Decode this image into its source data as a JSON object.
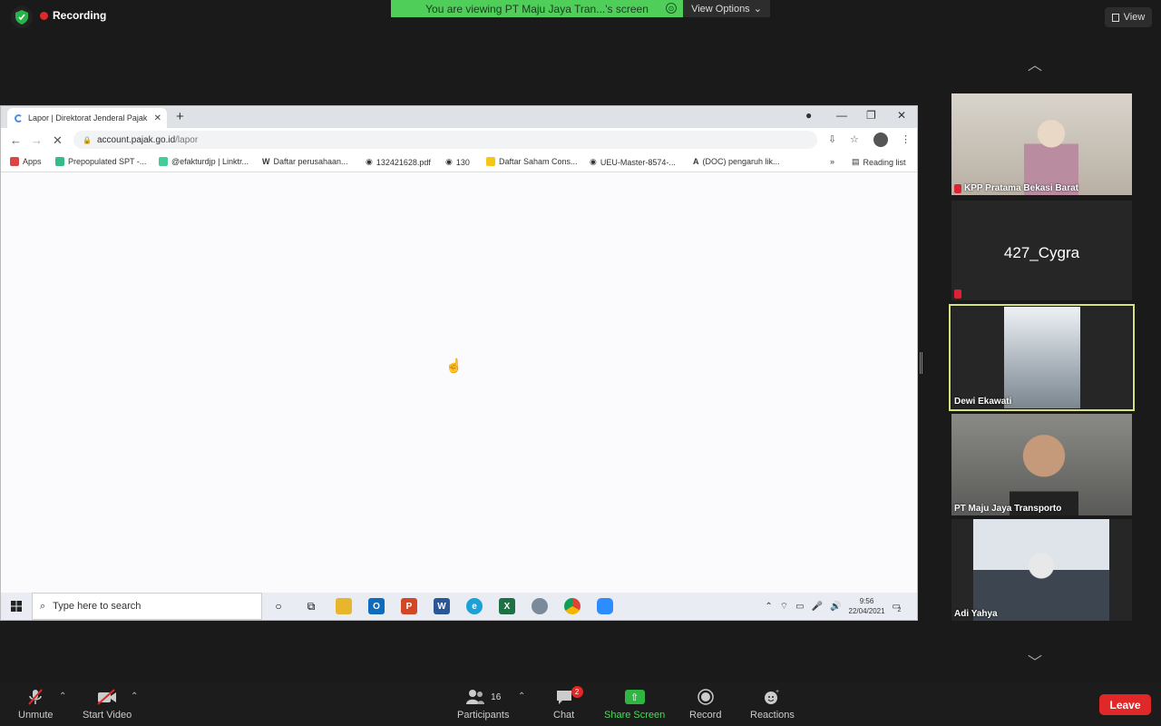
{
  "recording": {
    "label": "Recording"
  },
  "banner": {
    "viewing": "You are viewing PT Maju Jaya Tran...'s screen",
    "view_options": "View Options"
  },
  "view_button": {
    "label": "View"
  },
  "browser": {
    "tab_title": "Lapor | Direktorat Jenderal Pajak",
    "url_host": "account.pajak.go.id",
    "url_path": "/lapor",
    "bookmarks": [
      "Apps",
      "Prepopulated SPT -...",
      "@efakturdjp | Linktr...",
      "Daftar perusahaan...",
      "132421628.pdf",
      "130",
      "Daftar Saham Cons...",
      "UEU-Master-8574-...",
      "(DOC) pengaruh lik..."
    ],
    "reading_list": "Reading list"
  },
  "taskbar": {
    "search_placeholder": "Type here to search",
    "time": "9:56",
    "date": "22/04/2021",
    "notifications": "2"
  },
  "participants": [
    {
      "name": "KPP Pratama Bekasi Barat"
    },
    {
      "name": "427_Cygra"
    },
    {
      "name": "Dewi Ekawati"
    },
    {
      "name": "PT Maju Jaya Transporto"
    },
    {
      "name": "Adi Yahya"
    }
  ],
  "toolbar": {
    "unmute": "Unmute",
    "start_video": "Start Video",
    "participants_label": "Participants",
    "participants_count": "16",
    "chat": "Chat",
    "chat_badge": "2",
    "share_screen": "Share Screen",
    "record": "Record",
    "reactions": "Reactions",
    "leave": "Leave"
  }
}
